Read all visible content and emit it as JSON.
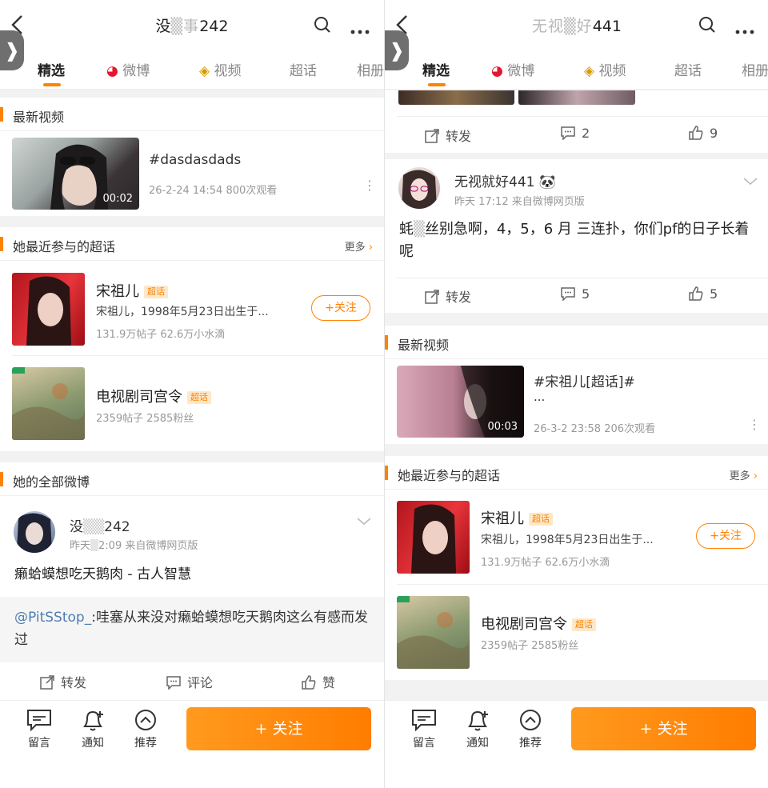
{
  "left": {
    "title_blur": "没",
    "title_mid": "事",
    "title_num": "242",
    "tabs": [
      {
        "label": "精选"
      },
      {
        "label": "微博"
      },
      {
        "label": "视频"
      },
      {
        "label": "超话"
      },
      {
        "label": "相册"
      }
    ],
    "latest_video_header": "最新视频",
    "video": {
      "title": "#dasdasdads",
      "duration": "00:02",
      "meta": "26-2-24 14:54 800次观看"
    },
    "topics_header": "她最近参与的超话",
    "topics_more": "更多",
    "topics": [
      {
        "name": "宋祖儿",
        "badge": "超话",
        "desc": "宋祖儿，1998年5月23日出生于...",
        "stats": "131.9万帖子 62.6万小水滴",
        "follow": "+关注"
      },
      {
        "name": "电视剧司宫令",
        "badge": "超话",
        "stats": "2359帖子 2585粉丝"
      }
    ],
    "all_posts_header": "她的全部微博",
    "post": {
      "user_start": "没",
      "user_end": "242",
      "meta_start": "昨天",
      "meta_end": "2:09 来自微博网页版",
      "body": "癞蛤蟆想吃天鹅肉 - 古人智慧",
      "quote_at": "@PitSStop_",
      "quote_text": ":哇塞从来没对癞蛤蟆想吃天鹅肉这么有感而发过",
      "repost": "转发",
      "comment": "评论",
      "like": "赞"
    },
    "bottom": {
      "message": "留言",
      "notify": "通知",
      "recommend": "推荐",
      "follow": "+ 关注"
    }
  },
  "right": {
    "title_blur": "无视",
    "title_mid": "好",
    "title_num": "441",
    "tabs": [
      {
        "label": "精选"
      },
      {
        "label": "微博"
      },
      {
        "label": "视频"
      },
      {
        "label": "超话"
      },
      {
        "label": "相册"
      }
    ],
    "post1_actions": {
      "repost": "转发",
      "comment": "2",
      "like": "9"
    },
    "post2": {
      "user": "无视就好441",
      "user_emoji": "🐼",
      "meta": "昨天 17:12 来自微博网页版",
      "body_start": "蚝",
      "body": "丝别急啊，4，5，6 月 三连扑，你们pf的日子长着呢",
      "repost": "转发",
      "comment": "5",
      "like": "5"
    },
    "latest_video_header": "最新视频",
    "video": {
      "title": "#宋祖儿[超话]#",
      "title2": "...",
      "duration": "00:03",
      "meta": "26-3-2 23:58 206次观看"
    },
    "topics_header": "她最近参与的超话",
    "topics_more": "更多",
    "topics": [
      {
        "name": "宋祖儿",
        "badge": "超话",
        "desc": "宋祖儿，1998年5月23日出生于...",
        "stats": "131.9万帖子 62.6万小水滴",
        "follow": "+关注"
      },
      {
        "name": "电视剧司宫令",
        "badge": "超话",
        "stats": "2359帖子 2585粉丝"
      }
    ],
    "bottom": {
      "message": "留言",
      "notify": "通知",
      "recommend": "推荐",
      "follow": "+ 关注"
    }
  },
  "colors": {
    "accent": "#ff8200",
    "link": "#507daf"
  }
}
